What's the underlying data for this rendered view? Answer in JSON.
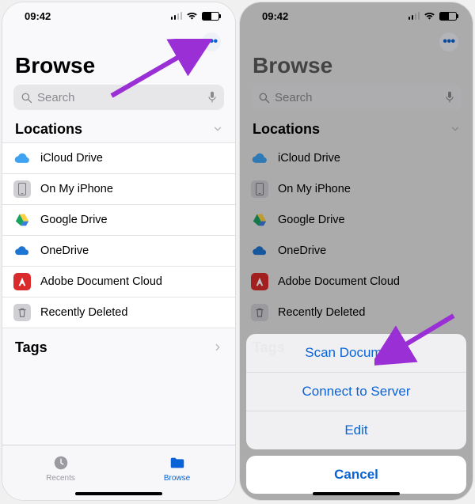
{
  "statusbar": {
    "time": "09:42"
  },
  "more_button_name": "more-options-icon",
  "title": "Browse",
  "search": {
    "placeholder": "Search"
  },
  "locations_header": "Locations",
  "locations": [
    {
      "name": "icloud-drive",
      "label": "iCloud Drive"
    },
    {
      "name": "on-my-iphone",
      "label": "On My iPhone"
    },
    {
      "name": "google-drive",
      "label": "Google Drive"
    },
    {
      "name": "onedrive",
      "label": "OneDrive"
    },
    {
      "name": "adobe-doc-cloud",
      "label": "Adobe Document Cloud"
    },
    {
      "name": "recently-deleted",
      "label": "Recently Deleted"
    }
  ],
  "tags_header": "Tags",
  "tabbar": {
    "recents_label": "Recents",
    "browse_label": "Browse"
  },
  "action_sheet": {
    "scan": "Scan Documents",
    "connect": "Connect to Server",
    "edit": "Edit",
    "cancel": "Cancel"
  }
}
